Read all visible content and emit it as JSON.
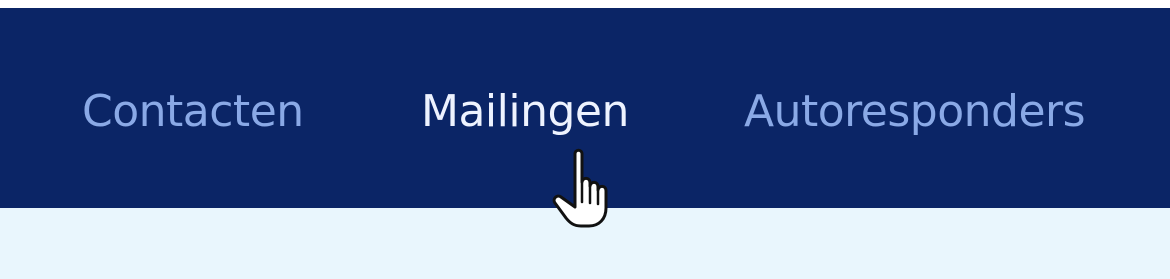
{
  "nav": {
    "items": [
      {
        "label": "Contacten",
        "state": "inactive"
      },
      {
        "label": "Mailingen",
        "state": "hover"
      },
      {
        "label": "Autoresponders",
        "state": "inactive"
      }
    ]
  },
  "colors": {
    "nav_background": "#0b2566",
    "nav_text_inactive": "#8aa9e6",
    "nav_text_active": "#eef3ff",
    "content_background": "#e9f6fd"
  },
  "cursor": {
    "icon": "hand-pointer-icon"
  }
}
